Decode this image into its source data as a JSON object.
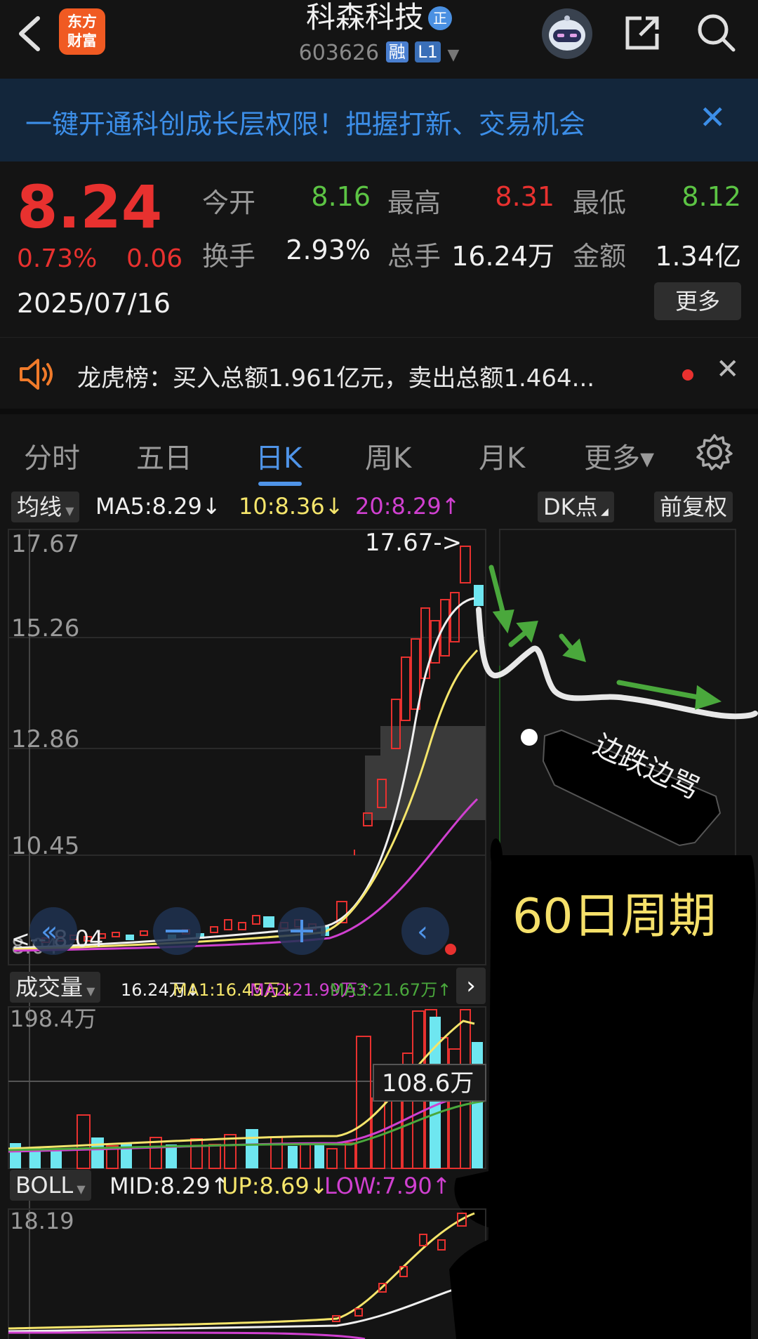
{
  "header": {
    "logo_line1": "东方",
    "logo_line2": "财富",
    "stock_name": "科森科技",
    "badge": "正",
    "stock_code": "603626",
    "tag_rong": "融",
    "tag_level": "L1"
  },
  "banner": {
    "text": "一键开通科创成长层权限！把握打新、交易机会",
    "close": "✕"
  },
  "quote": {
    "price": "8.24",
    "change_pct": "0.73%",
    "change": "0.06",
    "date": "2025/07/16",
    "fields": [
      {
        "label": "今开",
        "value": "8.16",
        "color": "#5cc444"
      },
      {
        "label": "最高",
        "value": "8.31",
        "color": "#e8312f"
      },
      {
        "label": "最低",
        "value": "8.12",
        "color": "#5cc444"
      },
      {
        "label": "换手",
        "value": "2.93%",
        "color": "#f0f0f0"
      },
      {
        "label": "总手",
        "value": "16.24万",
        "color": "#f0f0f0"
      },
      {
        "label": "金额",
        "value": "1.34亿",
        "color": "#f0f0f0"
      }
    ],
    "more": "更多"
  },
  "lhb": {
    "text": "龙虎榜：买入总额1.961亿元，卖出总额1.464...",
    "close": "✕"
  },
  "tabs": [
    "分时",
    "五日",
    "日K",
    "周K",
    "月K",
    "更多▾"
  ],
  "kline": {
    "ma_selector": "均线",
    "ma5": "MA5:8.29↓",
    "ma10": "10:8.36↓",
    "ma20": "20:8.29↑",
    "dk_button": "DK点",
    "fq_button": "前复权",
    "y_labels": [
      "17.67",
      "15.26",
      "12.86",
      "10.45"
    ],
    "bottom_label": "8.04",
    "low_marker": "<-- 8.04",
    "high_marker": "17.67->"
  },
  "volume": {
    "selector": "成交量",
    "vol": "16.24万↓",
    "ma1": "MA1:16.45万↓",
    "ma2": "MA2:21.99万↑",
    "ma3": "MA3:21.67万↑",
    "y_label": "198.4万",
    "cursor_label": "108.6万"
  },
  "boll": {
    "selector": "BOLL",
    "mid": "MID:8.29↑",
    "up": "UP:8.69↓",
    "low": "LOW:7.90↑",
    "y_label": "18.19"
  },
  "annotation": {
    "tag_text": "边跌边骂",
    "period_text": "60日周期"
  },
  "colors": {
    "up": "#e8312f",
    "down": "#5cc444",
    "accent": "#4f94e8",
    "ma10": "#f5e56b",
    "ma20": "#d040d0",
    "cyan": "#6ee6f0"
  }
}
